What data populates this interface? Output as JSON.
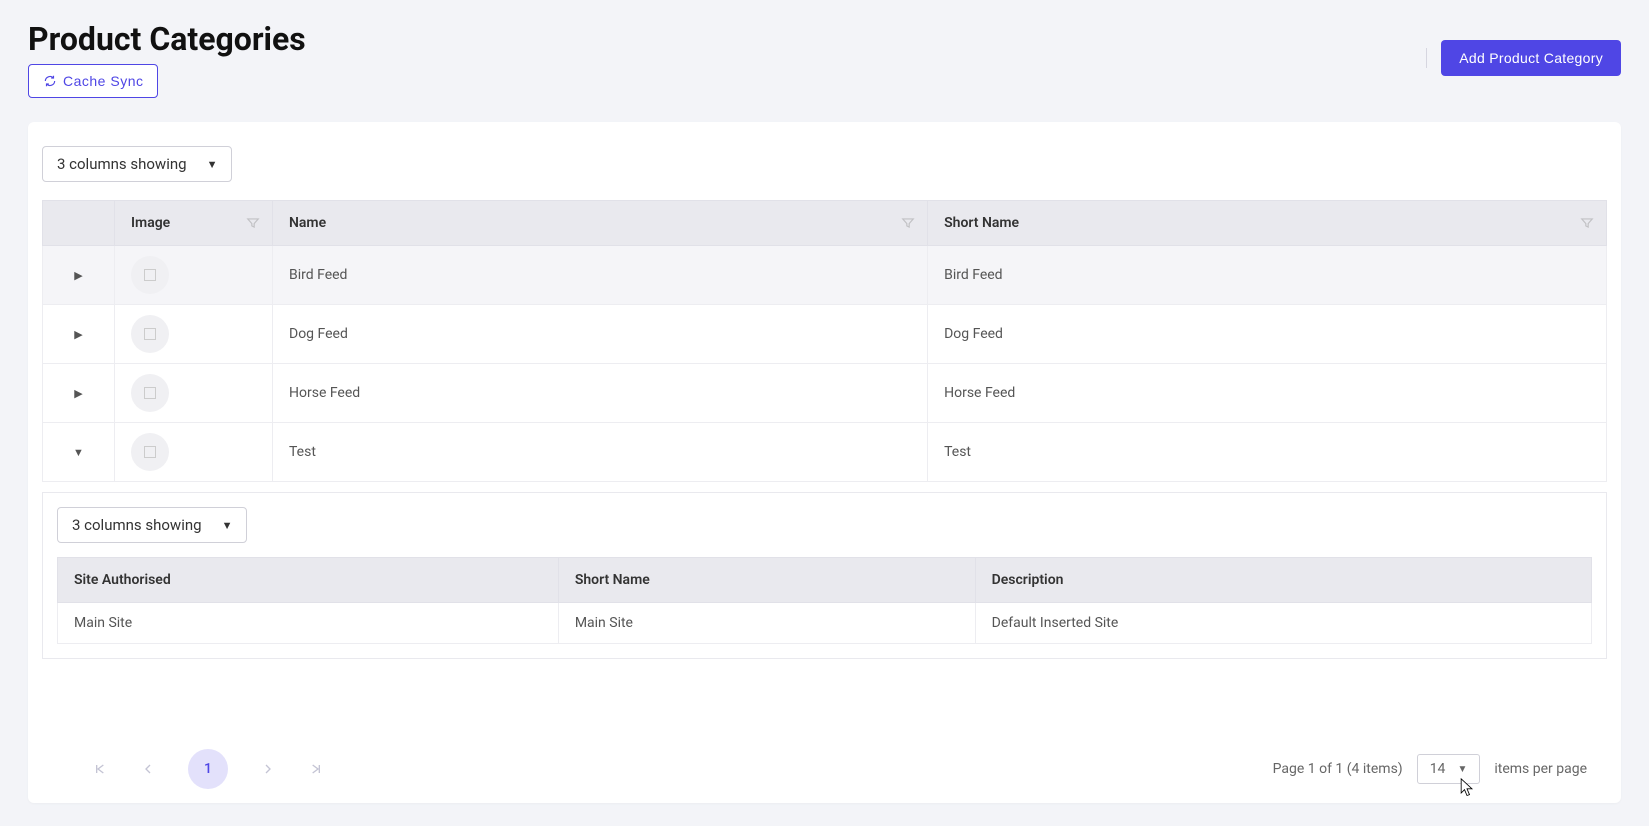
{
  "header": {
    "title": "Product Categories",
    "cache_sync_label": "Cache Sync",
    "add_button_label": "Add Product Category"
  },
  "column_picker": {
    "main_label": "3 columns showing",
    "sub_label": "3 columns showing"
  },
  "table": {
    "columns": {
      "image": "Image",
      "name": "Name",
      "short_name": "Short Name"
    },
    "rows": [
      {
        "name": "Bird Feed",
        "short_name": "Bird Feed",
        "expanded": false
      },
      {
        "name": "Dog Feed",
        "short_name": "Dog Feed",
        "expanded": false
      },
      {
        "name": "Horse Feed",
        "short_name": "Horse Feed",
        "expanded": false
      },
      {
        "name": "Test",
        "short_name": "Test",
        "expanded": true
      }
    ]
  },
  "subtable": {
    "columns": {
      "site_auth": "Site Authorised",
      "short_name": "Short Name",
      "description": "Description"
    },
    "rows": [
      {
        "site_auth": "Main Site",
        "short_name": "Main Site",
        "description": "Default Inserted Site"
      }
    ]
  },
  "pager": {
    "summary": "Page 1 of 1 (4 items)",
    "page_size": "14",
    "items_per_page_label": "items per page",
    "current_page": "1"
  }
}
